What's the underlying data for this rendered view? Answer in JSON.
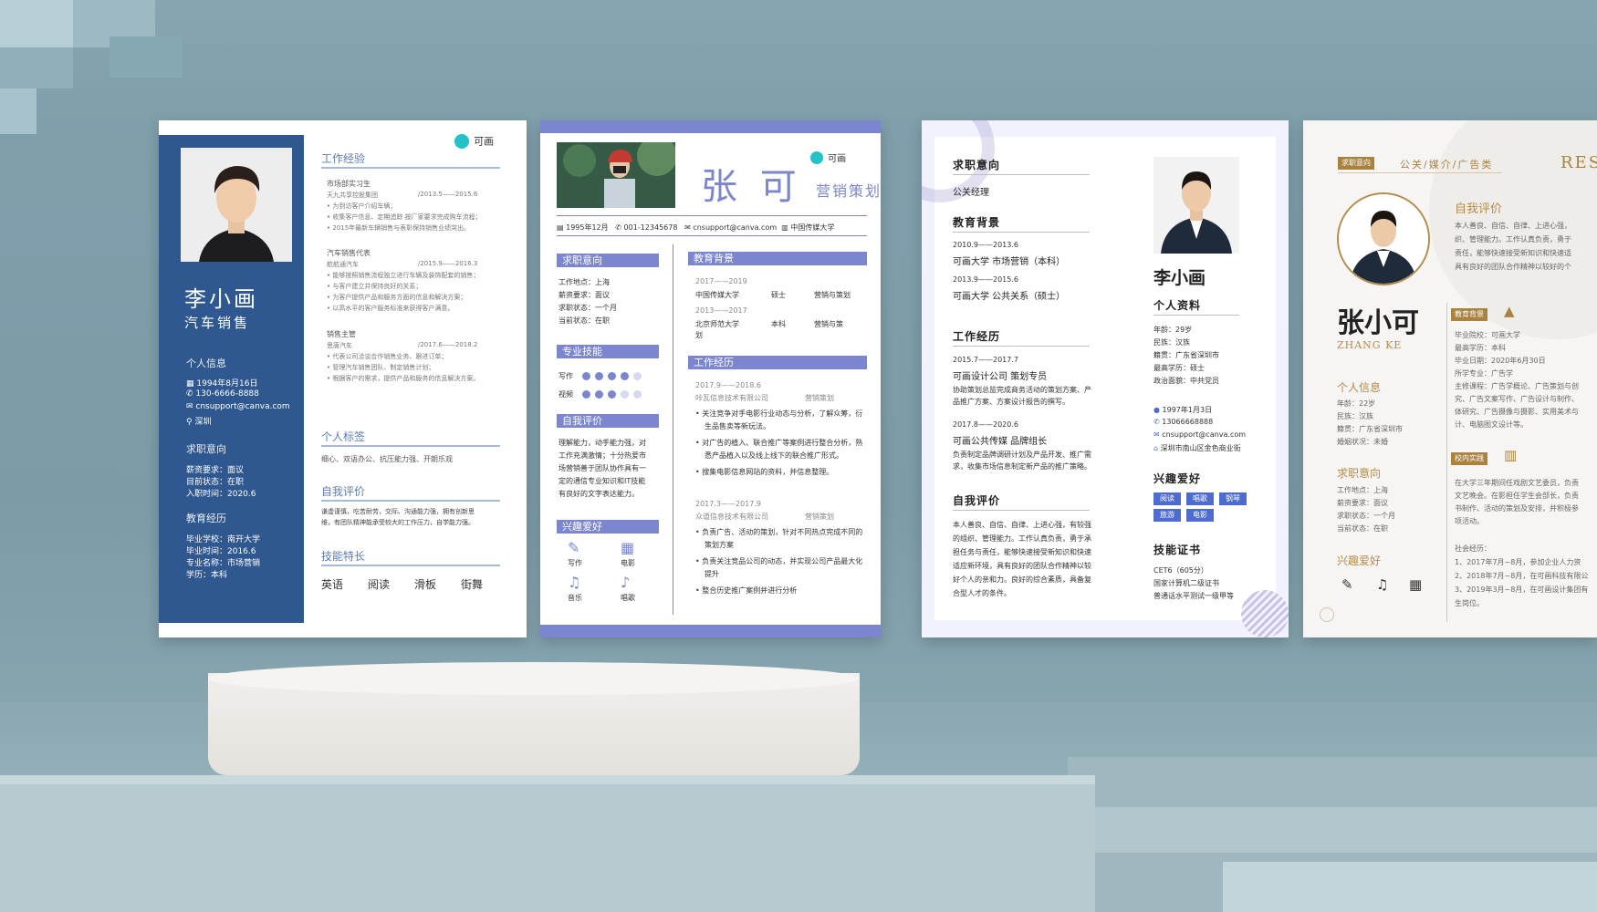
{
  "resumes": [
    {
      "name": "李小画",
      "title": "汽车销售",
      "logo": "可画",
      "personal_info_heading": "个人信息",
      "birthday": "1994年8月16日",
      "phone": "130-6666-8888",
      "email": "cnsupport@canva.com",
      "city": "深圳",
      "job_intent_heading": "求职意向",
      "salary": "薪资要求：面议",
      "status": "目前状态：在职",
      "start": "入职时间：2020.6",
      "edu_heading": "教育经历",
      "school": "毕业学校：南开大学",
      "grad": "毕业时间：2016.6",
      "major": "专业名称：市场营销",
      "degree": "学历：本科",
      "work_heading": "工作经验",
      "jobs": [
        {
          "role": "市场部实习生",
          "company": "天九共享控股集团",
          "period": "/2013.5——2015.6",
          "bullets": [
            "为到访客户介绍车辆；",
            "收集客户信息、定期追踪 按厂家要求完成购车流程；",
            "2015年最新车辆销售与表彰保持销售业绩突出。"
          ]
        },
        {
          "role": "汽车销售代表",
          "company": "航航通汽车",
          "period": "/2015.9——2016.3",
          "bullets": [
            "能够按照销售流程独立进行车辆及装饰配套的销售；",
            "与客户建立并保持良好的关系；",
            "为客户提供产品和服务方面的信息和解决方案；",
            "以高水平的客户服务标准来获得客户满意。"
          ]
        },
        {
          "role": "销售主管",
          "company": "思唐汽车",
          "period": "/2017.6——2018.2",
          "bullets": [
            "代表公司洽谈合作销售业务、跟进订单；",
            "管理汽车销售团队、制定销售计划；",
            "根据客户的需求，提供产品和服务的信息解决方案。"
          ]
        }
      ],
      "tag_heading": "个人标签",
      "tags": "细心、双语办公、抗压能力强、开朗乐观",
      "self_heading": "自我评价",
      "self": [
        "谦虚谨慎，吃苦耐劳，交际、沟通能力强，拥有创新思",
        "维，有团队精神能承受较大的工作压力，自学能力强。"
      ],
      "skill_heading": "技能特长",
      "skills": [
        "英语",
        "阅读",
        "滑板",
        "街舞"
      ]
    },
    {
      "name": "张 可",
      "title": "营销策划",
      "logo": "可画",
      "birth": "1995年12月",
      "phone": "001-12345678",
      "email": "cnsupport@canva.com",
      "school": "中国传媒大学",
      "intent_heading": "求职意向",
      "intent": [
        "工作地点：上海",
        "薪资要求：面议",
        "求职状态：一个月",
        "当前状态：在职"
      ],
      "skill_heading": "专业技能",
      "skills": [
        {
          "name": "写作",
          "level": 4
        },
        {
          "name": "视频",
          "level": 3
        }
      ],
      "self_heading": "自我评价",
      "self": [
        "理解能力，动手能力强，对",
        "工作充满激情；十分热爱市",
        "场营销善于团队协作具有一",
        "定的通信专业知识和IT技能",
        "有良好的文字表达能力。"
      ],
      "hobby_heading": "兴趣爱好",
      "hobbies": [
        "写作",
        "电影",
        "音乐",
        "唱歌"
      ],
      "edu_heading": "教育背景",
      "edu": [
        {
          "period": "2017——2019",
          "school": "中国传媒大学",
          "degree": "硕士",
          "major": "营销与策划"
        },
        {
          "period": "2013——2017",
          "school": "北京师范大学",
          "school2": "划",
          "degree": "本科",
          "major": "营销与策"
        }
      ],
      "work_heading": "工作经历",
      "work": [
        {
          "period": "2017.9——2018.6",
          "company": "咔瓦信息技术有限公司",
          "role": "营销策划",
          "bullets": [
            "关注竞争对手电影行业动态与分析，了解众筹，衍",
            "生品售卖等新玩法。",
            "对广告的植入、联合推广等案例进行整合分析，熟",
            "悉产品植入以及线上线下的联合推广形式。",
            "搜集电影信息网站的资料，并信息整理。"
          ]
        },
        {
          "period": "2017.3——2017.9",
          "company": "众道信息技术有限公司",
          "role": "营销策划",
          "bullets": [
            "负责广告、活动的策划，针对不同热点完成不同的",
            "策划方案",
            "负责关注竞品公司的动态，并实现公司产品最大化",
            "提升",
            "整合历史推广案例并进行分析"
          ]
        }
      ]
    },
    {
      "intent_heading": "求职意向",
      "intent": "公关经理",
      "edu_heading": "教育背景",
      "edu": [
        {
          "period": "2010.9——2013.6",
          "school": "可画大学  市场营销（本科）"
        },
        {
          "period": "2013.9——2015.6",
          "school": "可画大学  公共关系（硕士）"
        }
      ],
      "work_heading": "工作经历",
      "work": [
        {
          "period": "2015.7——2017.7",
          "company": "可画设计公司  策划专员",
          "desc": [
            "协助策划总监完成商务活动的策划方案、产",
            "品推广方案、方案设计报告的撰写。"
          ]
        },
        {
          "period": "2017.8——2020.6",
          "company": "可画公共传媒  品牌组长",
          "desc": [
            "负责制定品牌调研计划及产品开发、推广需",
            "求，收集市场信息制定新产品的推广策略。"
          ]
        }
      ],
      "self_heading": "自我评价",
      "self": [
        "本人善良、自信、自律、上进心强，有较强",
        "的组织、管理能力。工作认真负责，勇于承",
        "担任务与责任，能够快速接受新知识和快速",
        "适应新环境，具有良好的团队合作精神以较",
        "好个人的亲和力。良好的综合素质，具备复",
        "合型人才的条件。"
      ],
      "name": "李小画",
      "profile_heading": "个人资料",
      "profile": [
        "年龄：29岁",
        "民族：汉族",
        "籍贯：广东省深圳市",
        "最高学历：硕士",
        "政治面貌：中共党员"
      ],
      "birth": "1997年1月3日",
      "phone": "13066668888",
      "email": "cnsupport@canva.com",
      "address": "深圳市南山区金色商业街",
      "hobby_heading": "兴趣爱好",
      "hobbies": [
        "阅读",
        "唱歌",
        "钢琴",
        "旅游",
        "电影"
      ],
      "cert_heading": "技能证书",
      "certs": [
        "CET6（605分）",
        "国家计算机二级证书",
        "普通话水平测试一级甲等"
      ]
    },
    {
      "intent_tag": "求职意向",
      "intent": "公关/媒介/广告类",
      "res": "RES",
      "name": "张小可",
      "pinyin": "ZHANG KE",
      "info_heading": "个人信息",
      "info": [
        "年龄：22岁",
        "民族：汉族",
        "籍贯：广东省深圳市",
        "婚姻状况：未婚"
      ],
      "intent_heading": "求职意向",
      "intent_list": [
        "工作地点：上海",
        "薪资要求：面议",
        "求职状态：一个月",
        "当前状态：在职"
      ],
      "hobby_heading": "兴趣爱好",
      "self_heading": "自我评价",
      "self": [
        "本人善良、自信、自律、上进心强，",
        "织、管理能力。工作认真负责，勇于",
        "责任，能够快速接受新知识和快速适",
        "具有良好的团队合作精神以较好的个"
      ],
      "edu_tag": "教育背景",
      "edu": [
        "毕业院校：可画大学",
        "最高学历：本科",
        "毕业日期：2020年6月30日",
        "所学专业：广告学",
        "主修课程：广告学概论、广告策划与创",
        "究、广告文案写作、广告设计与制作、",
        "体研究、广告摄像与摄影、实用美术与",
        "计、电脑图文设计等。"
      ],
      "practice_tag": "校内实践",
      "practice": [
        "在大学三年期间任戏剧文艺委员，负责",
        "文艺晚会。在影担任学生会部长，负责",
        "书制作、活动的策划及安排，并积极参",
        "项活动。"
      ],
      "social_heading": "社会经历：",
      "social": [
        "1、2017年7月~8月，参加企业人力资",
        "2、2018年7月~8月，在可画科技有限公",
        "3、2019年3月~8月，在可画设计集团有",
        "生岗位。"
      ]
    }
  ]
}
